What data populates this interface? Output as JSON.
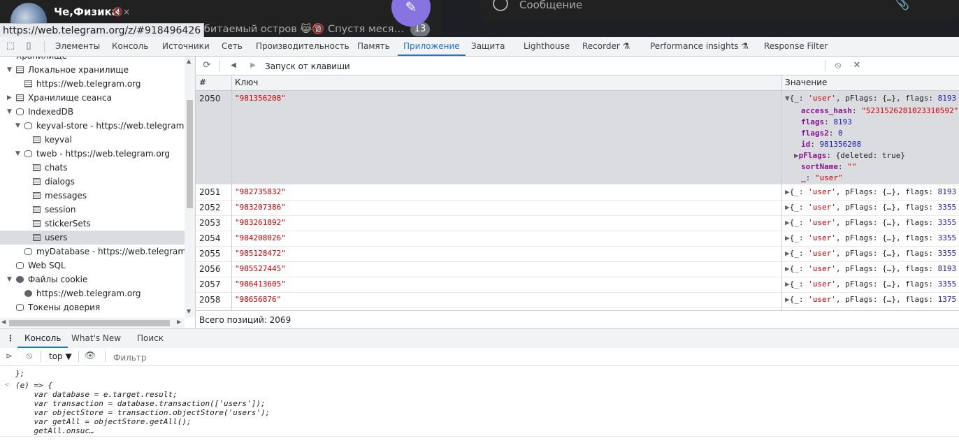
{
  "telegram": {
    "chat_name": "Че,Физика",
    "mute_glyph": "🔇×",
    "url": "https://web.telegram.org/z/#918496426",
    "preview": "обитаемый остров 😹🔞 Спустя меся…",
    "unread_badge": "13",
    "compose_glyph": "✎",
    "message_placeholder": "Сообщение",
    "clip_glyph": "📎"
  },
  "devtools": {
    "tabs": [
      {
        "label": "Элементы"
      },
      {
        "label": "Консоль"
      },
      {
        "label": "Источники"
      },
      {
        "label": "Сеть"
      },
      {
        "label": "Производительность"
      },
      {
        "label": "Память"
      },
      {
        "label": "Приложение",
        "active": true
      },
      {
        "label": "Защита"
      },
      {
        "label": "Lighthouse"
      },
      {
        "label": "Recorder ⚗"
      },
      {
        "label": "Performance insights ⚗"
      },
      {
        "label": "Response Filter"
      }
    ],
    "icons": {
      "inspect": "⬚",
      "device": "▯"
    }
  },
  "sidebar": {
    "items": [
      {
        "label": "Хранилище",
        "arrow": "",
        "icon": "",
        "indent": 0
      },
      {
        "label": "Локальное хранилище",
        "arrow": "▼",
        "icon": "grid",
        "indent": 0
      },
      {
        "label": "https://web.telegram.org",
        "arrow": "",
        "icon": "grid",
        "indent": 1
      },
      {
        "label": "Хранилище сеанса",
        "arrow": "▶",
        "icon": "grid",
        "indent": 0
      },
      {
        "label": "IndexedDB",
        "arrow": "▼",
        "icon": "db",
        "indent": 0
      },
      {
        "label": "keyval-store - https://web.telegram.org",
        "arrow": "▼",
        "icon": "db",
        "indent": 1
      },
      {
        "label": "keyval",
        "arrow": "",
        "icon": "grid",
        "indent": 2
      },
      {
        "label": "tweb - https://web.telegram.org",
        "arrow": "▼",
        "icon": "db",
        "indent": 1
      },
      {
        "label": "chats",
        "arrow": "",
        "icon": "grid",
        "indent": 2
      },
      {
        "label": "dialogs",
        "arrow": "",
        "icon": "grid",
        "indent": 2
      },
      {
        "label": "messages",
        "arrow": "",
        "icon": "grid",
        "indent": 2
      },
      {
        "label": "session",
        "arrow": "",
        "icon": "grid",
        "indent": 2
      },
      {
        "label": "stickerSets",
        "arrow": "",
        "icon": "grid",
        "indent": 2
      },
      {
        "label": "users",
        "arrow": "",
        "icon": "grid",
        "indent": 2,
        "selected": true
      },
      {
        "label": "myDatabase - https://web.telegram.org",
        "arrow": "",
        "icon": "db",
        "indent": 1
      },
      {
        "label": "Web SQL",
        "arrow": "",
        "icon": "db",
        "indent": 0
      },
      {
        "label": "Файлы cookie",
        "arrow": "▼",
        "icon": "cookie",
        "indent": 0
      },
      {
        "label": "https://web.telegram.org",
        "arrow": "",
        "icon": "cookie",
        "indent": 1
      },
      {
        "label": "Токены доверия",
        "arrow": "",
        "icon": "db",
        "indent": 0
      }
    ]
  },
  "idb": {
    "toolbar": {
      "refresh": "⟳",
      "prev": "◀",
      "next": "▶",
      "filter_value": "Запуск от клавиши",
      "clear": "⦸",
      "close": "✕"
    },
    "columns": {
      "num": "#",
      "key": "Ключ",
      "value": "Значение"
    },
    "expanded": {
      "num": "2050",
      "key": "\"981356208\"",
      "head_prefix": "{_: ",
      "head_type": "'user'",
      "head_mid": ", pFlags: {…}, flags: ",
      "head_flags": "8193",
      "props": [
        {
          "name": "access_hash",
          "value": "\"5231526281023310592\"",
          "kind": "str"
        },
        {
          "name": "flags",
          "value": "8193",
          "kind": "num"
        },
        {
          "name": "flags2",
          "value": "0",
          "kind": "num"
        },
        {
          "name": "id",
          "value": "981356208",
          "kind": "num"
        },
        {
          "name": "pFlags",
          "value": "{deleted: true}",
          "kind": "obj"
        },
        {
          "name": "sortName",
          "value": "\"\"",
          "kind": "str"
        },
        {
          "name": "_",
          "value": "\"user\"",
          "kind": "str"
        }
      ]
    },
    "rows": [
      {
        "num": "2051",
        "key": "\"982735832\"",
        "flags": "8193"
      },
      {
        "num": "2052",
        "key": "\"983207386\"",
        "flags": "3355"
      },
      {
        "num": "2053",
        "key": "\"983261892\"",
        "flags": "3355"
      },
      {
        "num": "2054",
        "key": "\"984208026\"",
        "flags": "3355"
      },
      {
        "num": "2055",
        "key": "\"985128472\"",
        "flags": "3355"
      },
      {
        "num": "2056",
        "key": "\"985527445\"",
        "flags": "8193"
      },
      {
        "num": "2057",
        "key": "\"986413605\"",
        "flags": "3355"
      },
      {
        "num": "2058",
        "key": "\"98656876\"",
        "flags": "1375"
      }
    ],
    "row_value_prefix": "{_: ",
    "row_value_type": "'user'",
    "row_value_mid": ", pFlags: {…}, flags: ",
    "total": "Всего позиций: 2069"
  },
  "drawer": {
    "tabs": [
      {
        "label": "Консоль",
        "active": true
      },
      {
        "label": "What's New"
      },
      {
        "label": "Поиск"
      }
    ],
    "context": "top ▼",
    "filter_placeholder": "Фильтр",
    "lines": [
      "};",
      "(e) => {",
      "    var database = e.target.result;",
      "    var transaction = database.transaction(['users']);",
      "    var objectStore = transaction.objectStore('users');",
      "    var getAll = objectStore.getAll();",
      "    getAll.onsuc…"
    ]
  },
  "colors": {
    "accent": "#1a73e8",
    "string": "#c80000",
    "number": "#1a1aa6",
    "property": "#881391",
    "telegram_accent": "#8774e1"
  }
}
